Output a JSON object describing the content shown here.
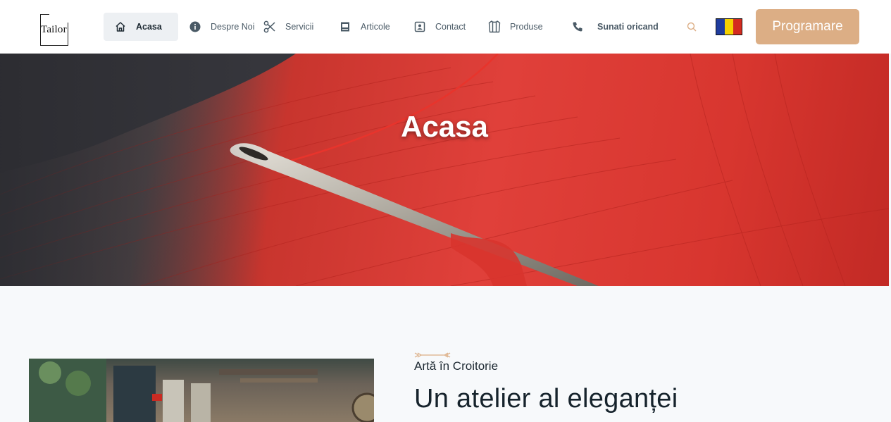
{
  "header": {
    "logo_text": "Tailor",
    "nav": [
      {
        "label": "Acasa",
        "icon": "home-icon",
        "active": true
      },
      {
        "label": "Despre Noi",
        "icon": "info-icon",
        "active": false
      },
      {
        "label": "Servicii",
        "icon": "scissors-icon",
        "active": false
      },
      {
        "label": "Articole",
        "icon": "article-icon",
        "active": false
      },
      {
        "label": "Contact",
        "icon": "contact-icon",
        "active": false
      },
      {
        "label": "Produse",
        "icon": "shirt-icon",
        "active": false
      },
      {
        "label": "Sunati oricand",
        "icon": "phone-icon",
        "active": false
      }
    ],
    "search_icon": "search-icon",
    "language_flag": {
      "name": "romania-flag",
      "colors": [
        "#1f3c9e",
        "#f6d200",
        "#d42b1f"
      ]
    },
    "cta_label": "Programare"
  },
  "hero": {
    "title": "Acasa"
  },
  "about": {
    "kicker": "Artă în Croitorie",
    "heading": "Un atelier al eleganței"
  },
  "colors": {
    "accent": "#dcae85",
    "hero_red": "#e0403a",
    "page_bg": "#f7f9fb"
  }
}
